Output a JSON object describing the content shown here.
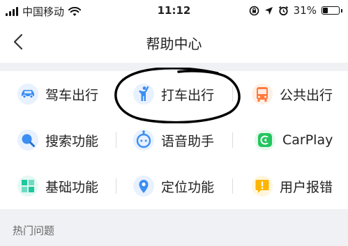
{
  "status": {
    "carrier": "中国移动",
    "time": "11:12",
    "battery": "31%",
    "battery_level": 0.31,
    "icons": [
      "signal-bars-icon",
      "wifi-icon",
      "rotation-lock-icon",
      "location-arrow-icon",
      "alarm-icon",
      "battery-icon"
    ]
  },
  "nav": {
    "title": "帮助中心",
    "back_icon": "chevron-left-icon"
  },
  "categories": [
    {
      "label": "驾车出行",
      "icon": "car-icon",
      "color": "#3b8ef3"
    },
    {
      "label": "打车出行",
      "icon": "hail-person-icon",
      "color": "#3b8ef3"
    },
    {
      "label": "公共出行",
      "icon": "bus-icon",
      "color": "#ff7a3c"
    },
    {
      "label": "搜索功能",
      "icon": "search-icon",
      "color": "#3b8ef3"
    },
    {
      "label": "语音助手",
      "icon": "voice-assistant-icon",
      "color": "#3b8ef3"
    },
    {
      "label": "CarPlay",
      "icon": "carplay-icon",
      "color": "#22c55e"
    },
    {
      "label": "基础功能",
      "icon": "grid-blocks-icon",
      "color": "#1ec7a0"
    },
    {
      "label": "定位功能",
      "icon": "location-pin-icon",
      "color": "#3b8ef3"
    },
    {
      "label": "用户报错",
      "icon": "report-flag-icon",
      "color": "#ffb400"
    }
  ],
  "section": {
    "hot_questions": "热门问题"
  },
  "colors": {
    "band": "#f0f1f4",
    "annotation": "#000000"
  }
}
